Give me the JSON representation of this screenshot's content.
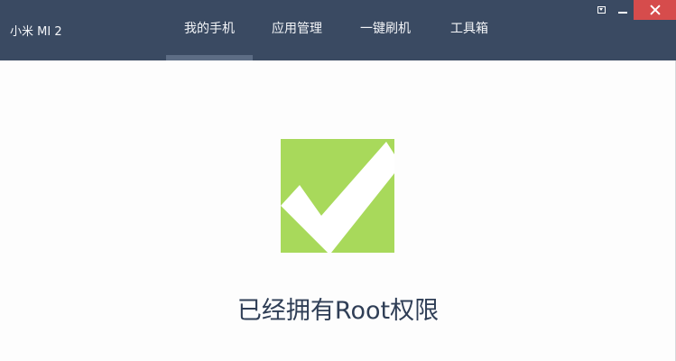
{
  "header": {
    "device_name": "小米 MI 2",
    "tabs": [
      {
        "label": "我的手机",
        "active": true
      },
      {
        "label": "应用管理",
        "active": false
      },
      {
        "label": "一键刷机",
        "active": false
      },
      {
        "label": "工具箱",
        "active": false
      }
    ]
  },
  "window_controls": {
    "menu_icon": "dropdown-menu-icon",
    "minimize_icon": "minimize-icon",
    "close_icon": "close-icon"
  },
  "main": {
    "status_icon": "checkmark-icon",
    "status_text": "已经拥有Root权限"
  },
  "colors": {
    "header_bg": "#3a4a62",
    "tab_active_indicator": "#5d6d85",
    "close_button": "#d64c4c",
    "check_green": "#a8d95b",
    "status_text": "#2f3e56"
  }
}
